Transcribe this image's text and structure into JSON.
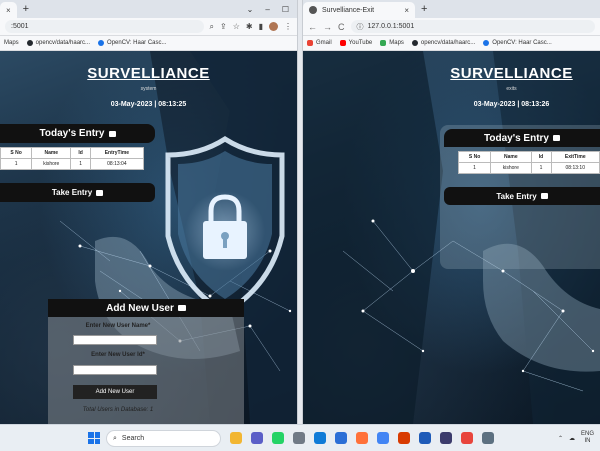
{
  "left_window": {
    "tab": {
      "title": "",
      "close": "×"
    },
    "newtab": "+",
    "controls": [
      "⌄",
      "–",
      "☐"
    ],
    "url": ":5001",
    "bookmarks": [
      {
        "label": "Maps",
        "color": "#34a853"
      },
      {
        "label": "opencv/data/haarc...",
        "color": "#24292f"
      },
      {
        "label": "OpenCV: Haar Casc...",
        "color": "#1a73e8"
      }
    ],
    "page": {
      "title": "SURVELLIANCE",
      "subtitle": "system",
      "datetime": "03-May-2023 | 08:13:25",
      "todays_entry": "Today's Entry",
      "table": {
        "headers": [
          "S No",
          "Name",
          "Id",
          "EntryTime"
        ],
        "rows": [
          [
            "1",
            "kishore",
            "1",
            "08:13:04"
          ]
        ]
      },
      "take_entry": "Take Entry",
      "form": {
        "heading": "Add New User",
        "name_label": "Enter New User Name*",
        "id_label": "Enter New User Id*",
        "button": "Add New User",
        "total": "Total Users in Database: 1"
      }
    }
  },
  "right_window": {
    "tab": {
      "title": "Survelliance-Exit",
      "close": "×"
    },
    "newtab": "+",
    "url": "127.0.0.1:5001",
    "bookmarks": [
      {
        "label": "Gmail",
        "color": "#ea4335"
      },
      {
        "label": "YouTube",
        "color": "#ff0000"
      },
      {
        "label": "Maps",
        "color": "#34a853"
      },
      {
        "label": "opencv/data/haarc...",
        "color": "#24292f"
      },
      {
        "label": "OpenCV: Haar Casc...",
        "color": "#1a73e8"
      }
    ],
    "page": {
      "title": "SURVELLIANCE",
      "subtitle": "exits",
      "datetime": "03-May-2023 | 08:13:26",
      "todays_entry": "Today's Entry",
      "table": {
        "headers": [
          "S No",
          "Name",
          "Id",
          "ExitTime"
        ],
        "rows": [
          [
            "1",
            "kishore",
            "1",
            "08:13:10"
          ]
        ]
      },
      "take_entry": "Take Entry"
    }
  },
  "taskbar": {
    "search_label": "Search",
    "apps": [
      {
        "name": "file-explorer-icon",
        "color": "#f2b632"
      },
      {
        "name": "chat-icon",
        "color": "#5b5fc7"
      },
      {
        "name": "whatsapp-icon",
        "color": "#25d366"
      },
      {
        "name": "settings-icon",
        "color": "#707a86"
      },
      {
        "name": "edge-icon",
        "color": "#0f7bd7"
      },
      {
        "name": "store-icon",
        "color": "#2b6fd6"
      },
      {
        "name": "firefox-icon",
        "color": "#ff7139"
      },
      {
        "name": "chrome-icon",
        "color": "#4285f4"
      },
      {
        "name": "office-icon",
        "color": "#d83b01"
      },
      {
        "name": "bluetooth-icon",
        "color": "#1e5bb8"
      },
      {
        "name": "app-icon",
        "color": "#3c3c6c"
      },
      {
        "name": "chrome-profile-icon",
        "color": "#e8453c"
      },
      {
        "name": "monitor-icon",
        "color": "#5c7080"
      }
    ],
    "tray": {
      "lang_top": "ENG",
      "lang_bottom": "IN"
    }
  }
}
